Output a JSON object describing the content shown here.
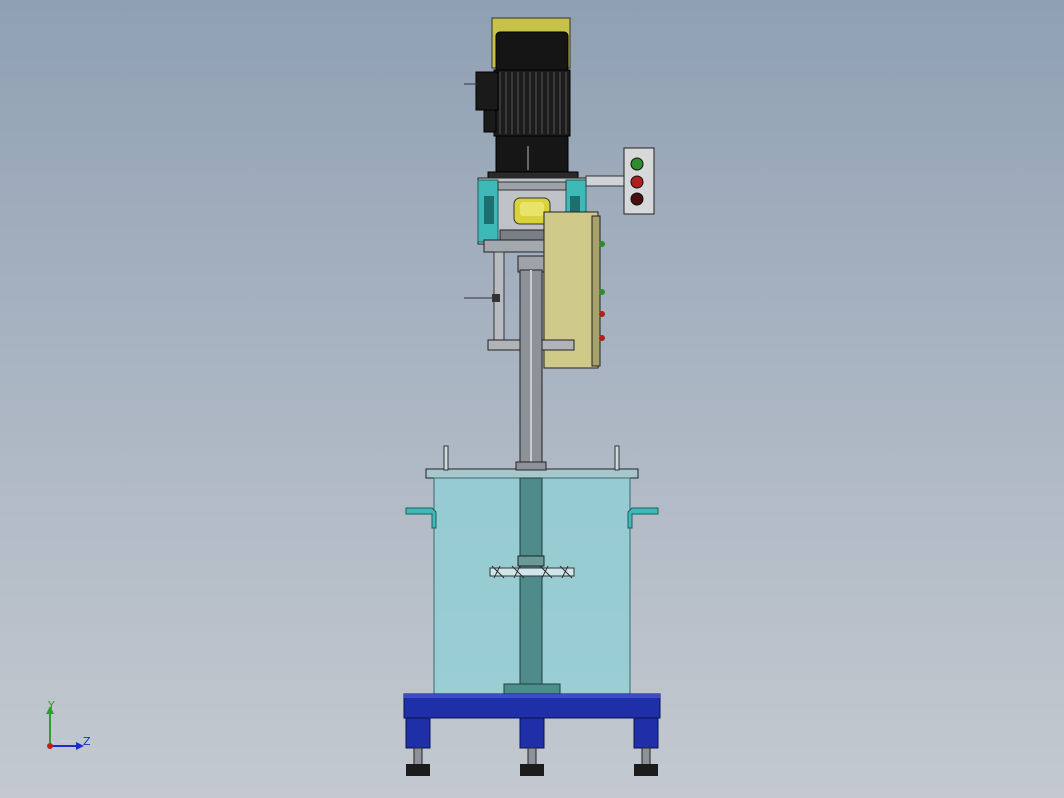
{
  "viewport": {
    "background_top": "#8fa0b3",
    "background_bottom": "#c4c9d0"
  },
  "model": {
    "motor_color": "#1a1a1a",
    "nameplate_color": "#c8c24a",
    "bracket_color": "#3fb8b8",
    "panel_color": "#cfc98a",
    "tank_color": "#8fd0d6",
    "frame_color": "#1f2fa8",
    "button_colors": [
      "#2e8b2e",
      "#b02020",
      "#4a1010"
    ]
  },
  "triad": {
    "y_label": "Y",
    "z_label": "Z",
    "y_color": "#2ca02c",
    "z_color": "#1a2fc9",
    "origin_color": "#c02020"
  }
}
